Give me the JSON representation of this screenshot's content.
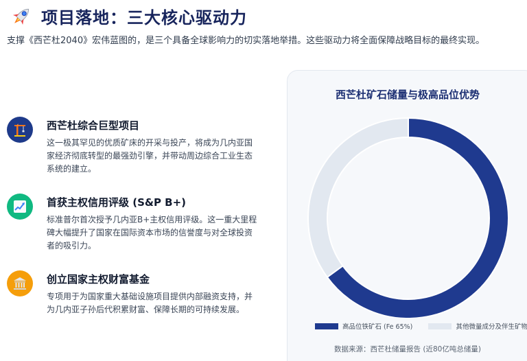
{
  "header": {
    "title": "项目落地：三大核心驱动力",
    "subtitle": "支撑《西芒杜2040》宏伟蓝图的，是三个具备全球影响力的切实落地举措。这些驱动力将全面保障战略目标的最终实现。"
  },
  "items": [
    {
      "title": "西芒杜综合巨型项目",
      "desc": "这一极其罕见的优质矿床的开采与投产，将成为几内亚国家经济彻底转型的最强劲引擎，并带动周边综合工业生态系统的建立。",
      "icon": "crane-icon",
      "color": "#1e3a8a"
    },
    {
      "title": "首获主权信用评级 (S&P B+)",
      "desc": "标准普尔首次授予几内亚B+主权信用评级。这一重大里程碑大幅提升了国家在国际资本市场的信誉度与对全球投资者的吸引力。",
      "icon": "trend-chart-icon",
      "color": "#10b981"
    },
    {
      "title": "创立国家主权财富基金",
      "desc": "专项用于为国家重大基础设施项目提供内部融资支持，并为几内亚子孙后代积累财富、保障长期的可持续发展。",
      "icon": "bank-icon",
      "color": "#f59e0b"
    }
  ],
  "chart_data": {
    "type": "pie",
    "donut": true,
    "title": "西芒杜矿石储量与极高品位优势",
    "categories": [
      "高品位铁矿石 (Fe 65%)",
      "其他微量成分及伴生矿物"
    ],
    "values": [
      65,
      35
    ],
    "colors": [
      "#1f3a8f",
      "#e2e8f0"
    ],
    "legend": "bottom",
    "source": "数据来源：西芒杜储量报告 (近80亿吨总储量)"
  }
}
